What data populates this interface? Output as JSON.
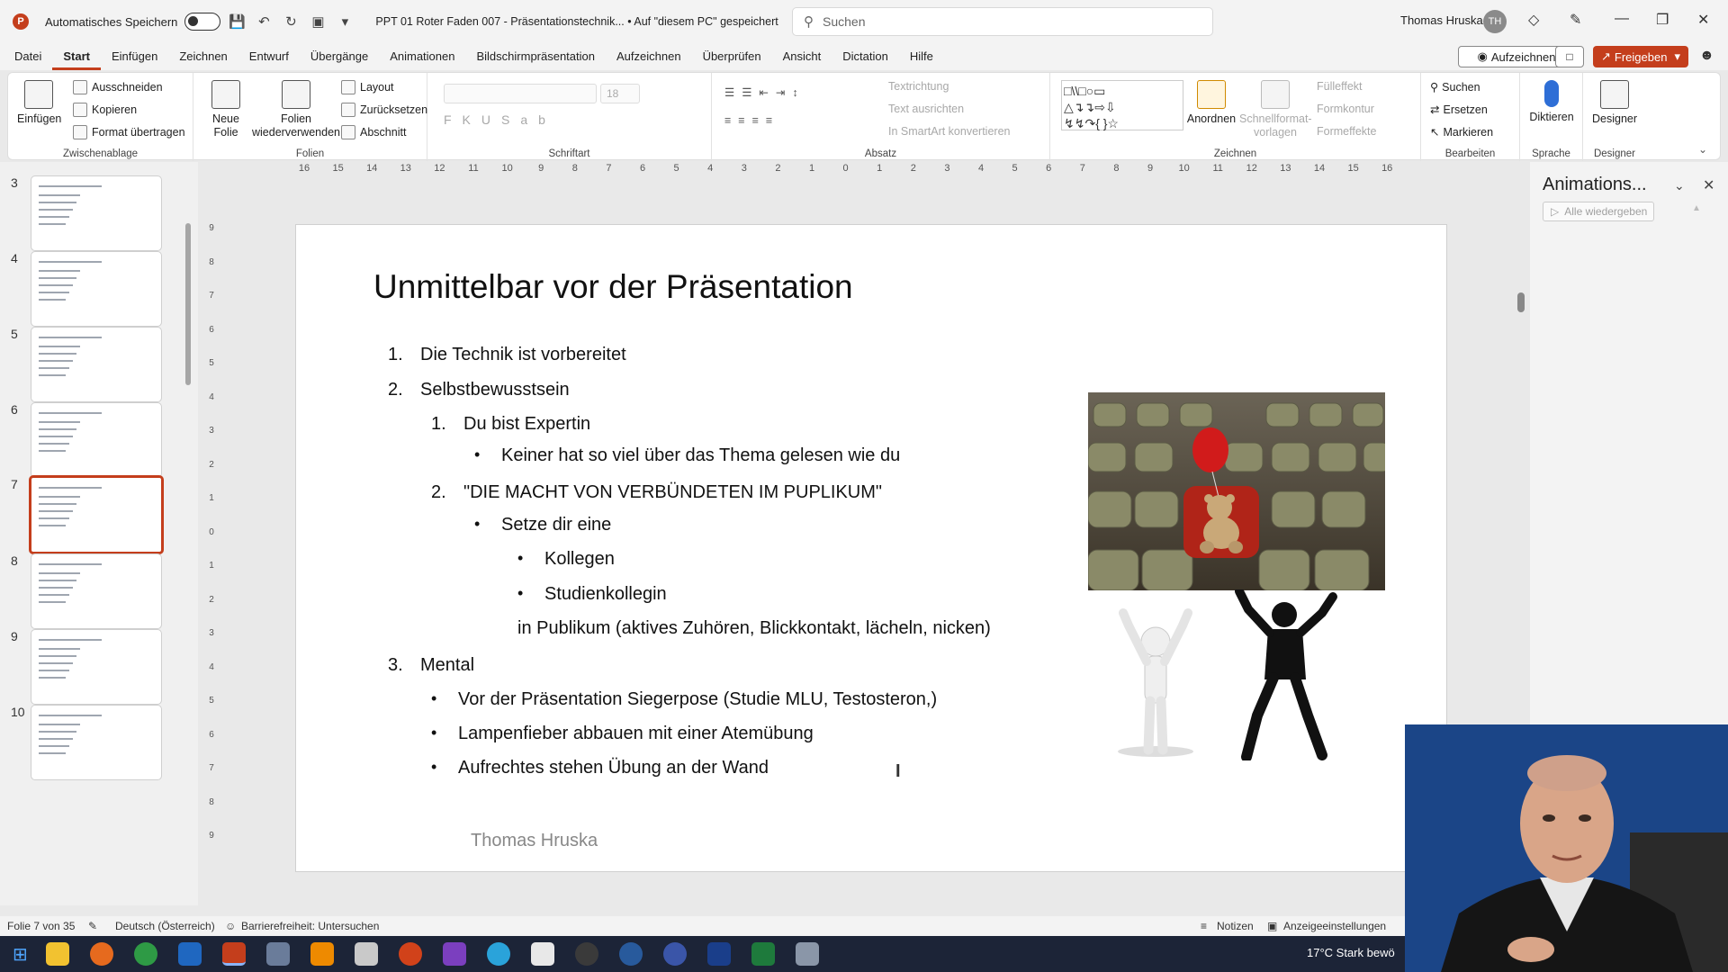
{
  "titlebar": {
    "autosave_label": "Automatisches Speichern",
    "doc_title": "PPT 01 Roter Faden 007 - Präsentationstechnik...  •  Auf \"diesem PC\" gespeichert",
    "search_placeholder": "Suchen",
    "user_name": "Thomas Hruska",
    "user_initials": "TH"
  },
  "menu": {
    "items": [
      "Datei",
      "Start",
      "Einfügen",
      "Zeichnen",
      "Entwurf",
      "Übergänge",
      "Animationen",
      "Bildschirmpräsentation",
      "Aufzeichnen",
      "Überprüfen",
      "Ansicht",
      "Dictation",
      "Hilfe"
    ],
    "active": "Start",
    "record_label": "Aufzeichnen",
    "share_label": "Freigeben"
  },
  "ribbon": {
    "clipboard": {
      "paste": "Einfügen",
      "cut": "Ausschneiden",
      "copy": "Kopieren",
      "format_painter": "Format übertragen",
      "label": "Zwischenablage"
    },
    "slides": {
      "new_slide": "Neue Folie",
      "reuse": "Folien wiederverwenden",
      "layout": "Layout",
      "reset": "Zurücksetzen",
      "section": "Abschnitt",
      "label": "Folien"
    },
    "font": {
      "size": "18",
      "label": "Schriftart"
    },
    "paragraph": {
      "text_direction": "Textrichtung",
      "align_text": "Text ausrichten",
      "smartart": "In SmartArt konvertieren",
      "label": "Absatz"
    },
    "drawing": {
      "arrange": "Anordnen",
      "quick_styles": "Schnellformat-vorlagen",
      "fill": "Fülleffekt",
      "outline": "Formkontur",
      "effects": "Formeffekte",
      "label": "Zeichnen"
    },
    "editing": {
      "find": "Suchen",
      "replace": "Ersetzen",
      "select": "Markieren",
      "label": "Bearbeiten"
    },
    "voice": {
      "dictate": "Diktieren",
      "label": "Sprache"
    },
    "designer": {
      "designer": "Designer",
      "label": "Designer"
    }
  },
  "ruler": {
    "h_ticks": [
      "16",
      "15",
      "14",
      "13",
      "12",
      "11",
      "10",
      "9",
      "8",
      "7",
      "6",
      "5",
      "4",
      "3",
      "2",
      "1",
      "0",
      "1",
      "2",
      "3",
      "4",
      "5",
      "6",
      "7",
      "8",
      "9",
      "10",
      "11",
      "12",
      "13",
      "14",
      "15",
      "16"
    ],
    "v_ticks": [
      "9",
      "8",
      "7",
      "6",
      "5",
      "4",
      "3",
      "2",
      "1",
      "0",
      "1",
      "2",
      "3",
      "4",
      "5",
      "6",
      "7",
      "8",
      "9"
    ]
  },
  "thumbnails": [
    {
      "num": "3",
      "selected": false
    },
    {
      "num": "4",
      "selected": false
    },
    {
      "num": "5",
      "selected": false
    },
    {
      "num": "6",
      "selected": false
    },
    {
      "num": "7",
      "selected": true
    },
    {
      "num": "8",
      "selected": false
    },
    {
      "num": "9",
      "selected": false
    },
    {
      "num": "10",
      "selected": false
    }
  ],
  "slide": {
    "title": "Unmittelbar vor der Präsentation",
    "items": {
      "n1": "1.",
      "t1": "Die Technik ist vorbereitet",
      "n2": "2.",
      "t2": "Selbstbewusstsein",
      "n21": "1.",
      "t21": "Du bist Expertin",
      "t211": "Keiner hat so viel über das Thema gelesen wie du",
      "n22": "2.",
      "t22": "\"DIE MACHT VON VERBÜNDETEN IM PUPLIKUM\"",
      "t221": "Setze dir eine",
      "t2211": "Kollegen",
      "t2212": "Studienkollegin",
      "t222": "in Publikum (aktives Zuhören, Blickkontakt, lächeln, nicken)",
      "n3": "3.",
      "t3": "Mental",
      "t31": "Vor der Präsentation Siegerpose (Studie MLU, Testosteron,)",
      "t32": "Lampenfieber abbauen mit einer Atemübung",
      "t33": "Aufrechtes stehen Übung an der Wand"
    },
    "footer": "Thomas Hruska",
    "bullet": "•"
  },
  "animations": {
    "title": "Animations...",
    "play_all": "Alle wiedergeben"
  },
  "status": {
    "slide_of": "Folie 7 von 35",
    "language": "Deutsch (Österreich)",
    "accessibility": "Barrierefreiheit: Untersuchen",
    "notes": "Notizen",
    "display_settings": "Anzeigeeinstellungen"
  },
  "taskbar": {
    "weather": "17°C  Stark bewö"
  },
  "colors": {
    "accent": "#c43e1c",
    "taskbar": "#1c2437"
  }
}
